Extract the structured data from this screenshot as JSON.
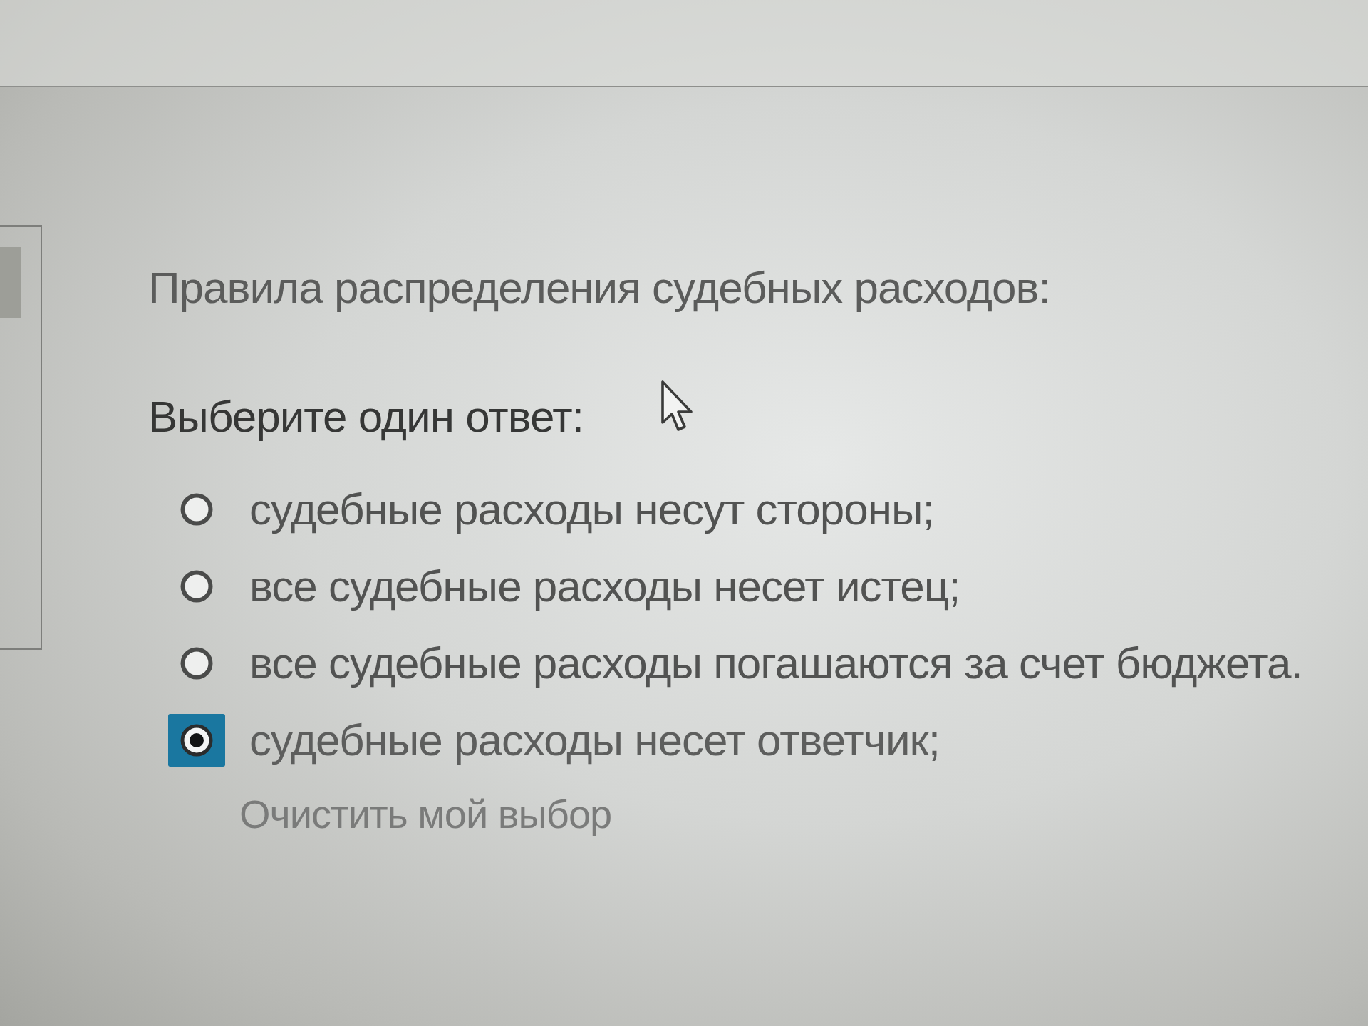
{
  "question": "Правила распределения судебных расходов:",
  "prompt": "Выберите один ответ:",
  "options": [
    {
      "label": "судебные расходы несут стороны;",
      "selected": false
    },
    {
      "label": "все судебные расходы несет истец;",
      "selected": false
    },
    {
      "label": "все судебные расходы погашаются за счет бюджета.",
      "selected": false
    },
    {
      "label": "судебные расходы несет ответчик;",
      "selected": true
    }
  ],
  "clear_choice": "Очистить мой выбор"
}
